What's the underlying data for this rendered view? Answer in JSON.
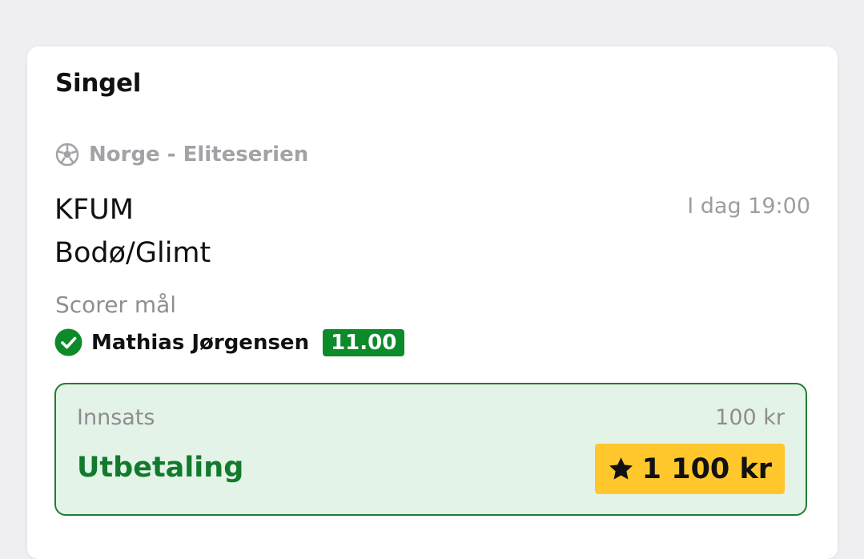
{
  "bet_slip": {
    "bet_type": "Singel",
    "league": {
      "icon": "soccer-ball-icon",
      "name": "Norge - Eliteserien"
    },
    "match": {
      "home_team": "KFUM",
      "away_team": "Bodø/Glimt",
      "time": "I dag 19:00"
    },
    "market": "Scorer mål",
    "selection": {
      "icon": "check-circle-icon",
      "name": "Mathias Jørgensen",
      "odds": "11.00"
    },
    "summary": {
      "stake_label": "Innsats",
      "stake_value": "100 kr",
      "payout_label": "Utbetaling",
      "payout_icon": "star-icon",
      "payout_value": "1 100 kr"
    }
  },
  "colors": {
    "background": "#efeef1",
    "card": "#ffffff",
    "accent_green": "#127a2c",
    "odds_green": "#0d8a2a",
    "summary_bg": "#e4f3e7",
    "payout_yellow": "#ffc72c",
    "muted_text": "#a3a3a7"
  }
}
